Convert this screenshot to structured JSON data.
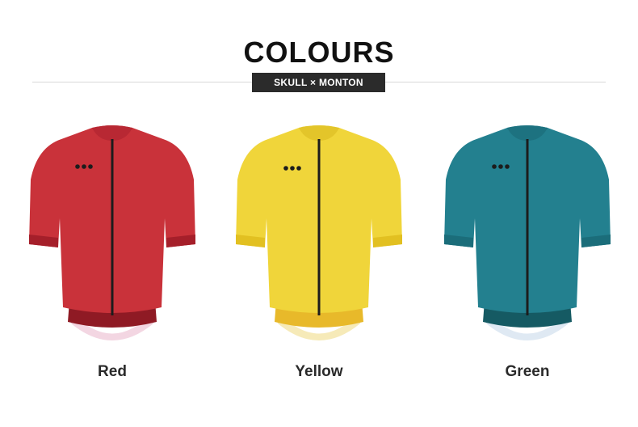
{
  "header": {
    "title": "COLOURS",
    "subtitle": "SKULL × MONTON"
  },
  "jerseys": [
    {
      "label": "Red",
      "body": "#c9323a",
      "dark": "#a51f2a",
      "band": "#8f1a24",
      "hem": "#f3d6e2",
      "collar": "#b82833"
    },
    {
      "label": "Yellow",
      "body": "#f0d53a",
      "dark": "#e2c021",
      "band": "#e8b92a",
      "hem": "#f6eab8",
      "collar": "#e3c52a"
    },
    {
      "label": "Green",
      "body": "#23808f",
      "dark": "#1b6d7a",
      "band": "#155a63",
      "hem": "#dfe9f3",
      "collar": "#1d7280"
    }
  ]
}
